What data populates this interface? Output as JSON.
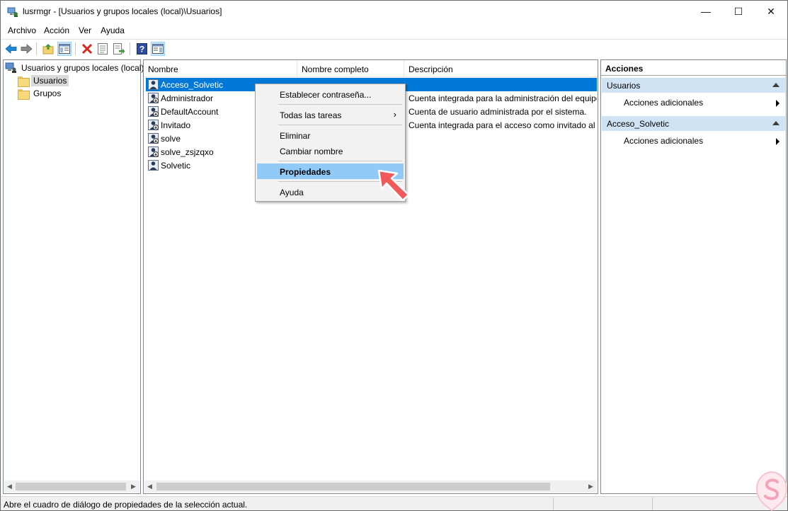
{
  "window": {
    "title": "lusrmgr - [Usuarios y grupos locales (local)\\Usuarios]",
    "controls": {
      "minimize": "—",
      "maximize": "☐",
      "close": "✕"
    }
  },
  "menubar": [
    {
      "label": "Archivo"
    },
    {
      "label": "Acción"
    },
    {
      "label": "Ver"
    },
    {
      "label": "Ayuda"
    }
  ],
  "toolbar": {
    "icons": [
      "back-arrow-icon",
      "forward-arrow-icon",
      "up-folder-icon",
      "show-hide-tree-icon",
      "delete-icon",
      "properties-icon",
      "export-list-icon",
      "help-icon",
      "show-hide-action-pane-icon"
    ]
  },
  "tree": {
    "root": "Usuarios y grupos locales (local)",
    "nodes": [
      {
        "label": "Usuarios",
        "selected": true
      },
      {
        "label": "Grupos",
        "selected": false
      }
    ]
  },
  "list": {
    "columns": [
      "Nombre",
      "Nombre completo",
      "Descripción"
    ],
    "rows": [
      {
        "name": "Acceso_Solvetic",
        "full_name": "",
        "description": "",
        "selected": true
      },
      {
        "name": "Administrador",
        "full_name": "",
        "description": "Cuenta integrada para la administración del equipo/d"
      },
      {
        "name": "DefaultAccount",
        "full_name": "",
        "description": "Cuenta de usuario administrada por el sistema."
      },
      {
        "name": "Invitado",
        "full_name": "",
        "description": "Cuenta integrada para el acceso como invitado al equi"
      },
      {
        "name": "solve",
        "full_name": "",
        "description": ""
      },
      {
        "name": "solve_zsjzqxo",
        "full_name": "",
        "description": ""
      },
      {
        "name": "Solvetic",
        "full_name": "",
        "description": ""
      }
    ]
  },
  "context_menu": {
    "items": [
      {
        "label": "Establecer contraseña..."
      },
      {
        "label": "Todas las tareas",
        "submenu": "›"
      },
      {
        "label": "Eliminar"
      },
      {
        "label": "Cambiar nombre"
      },
      {
        "label": "Propiedades",
        "highlighted": true
      },
      {
        "label": "Ayuda"
      }
    ]
  },
  "actions": {
    "title": "Acciones",
    "sections": [
      {
        "label": "Usuarios",
        "items": [
          {
            "label": "Acciones adicionales"
          }
        ]
      },
      {
        "label": "Acceso_Solvetic",
        "items": [
          {
            "label": "Acciones adicionales"
          }
        ]
      }
    ]
  },
  "statusbar": {
    "text": "Abre el cuadro de diálogo de propiedades de la selección actual."
  },
  "colors": {
    "selection": "#0078d7",
    "menu_highlight": "#91c9f7",
    "action_section": "#cfe3f5",
    "pointer_arrow": "#f05a5a"
  }
}
